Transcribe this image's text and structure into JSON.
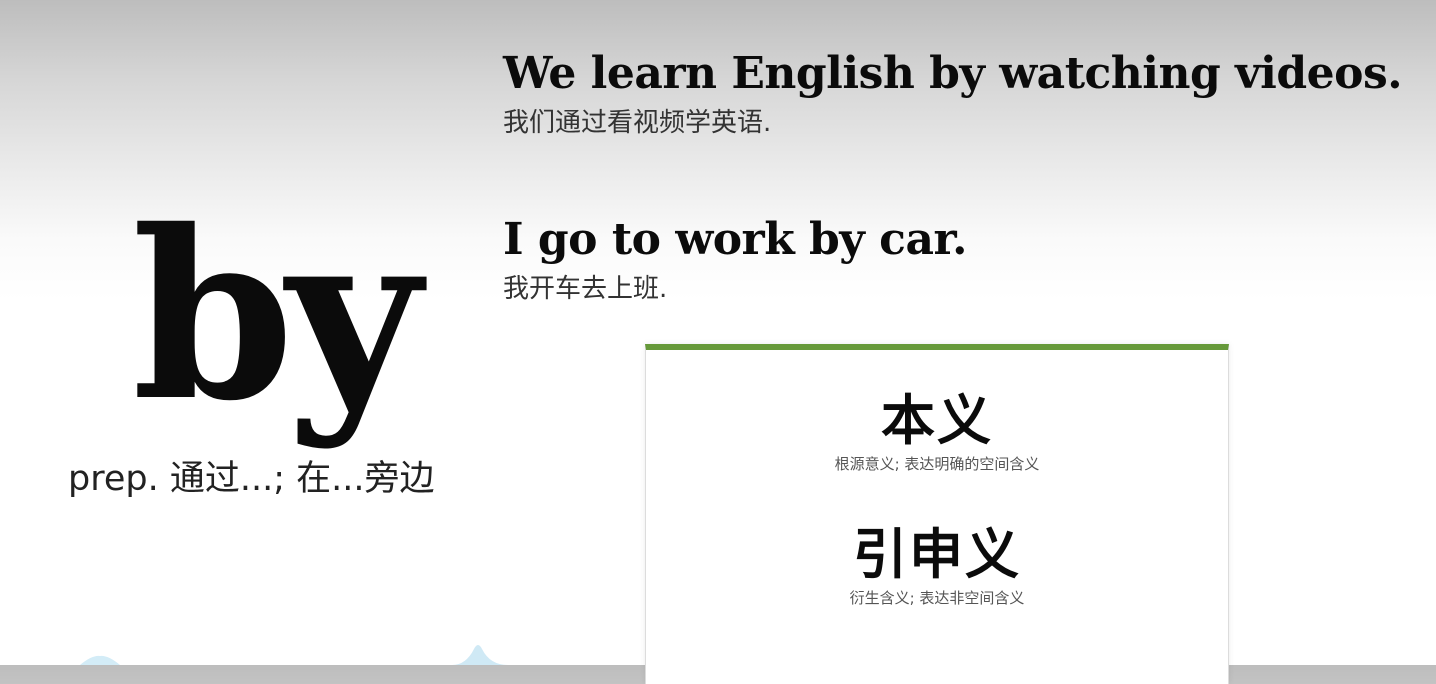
{
  "word": {
    "headword": "by",
    "definition": "prep. 通过...; 在...旁边"
  },
  "examples": [
    {
      "english": "We learn English by watching videos.",
      "chinese": "我们通过看视频学英语."
    },
    {
      "english": "I go to work by car.",
      "chinese": "我开车去上班."
    }
  ],
  "card": {
    "accent_color": "#66993a",
    "meanings": [
      {
        "title": "本义",
        "subtitle": "根源意义; 表达明确的空间含义"
      },
      {
        "title": "引申义",
        "subtitle": "衍生含义; 表达非空间含义"
      }
    ]
  }
}
